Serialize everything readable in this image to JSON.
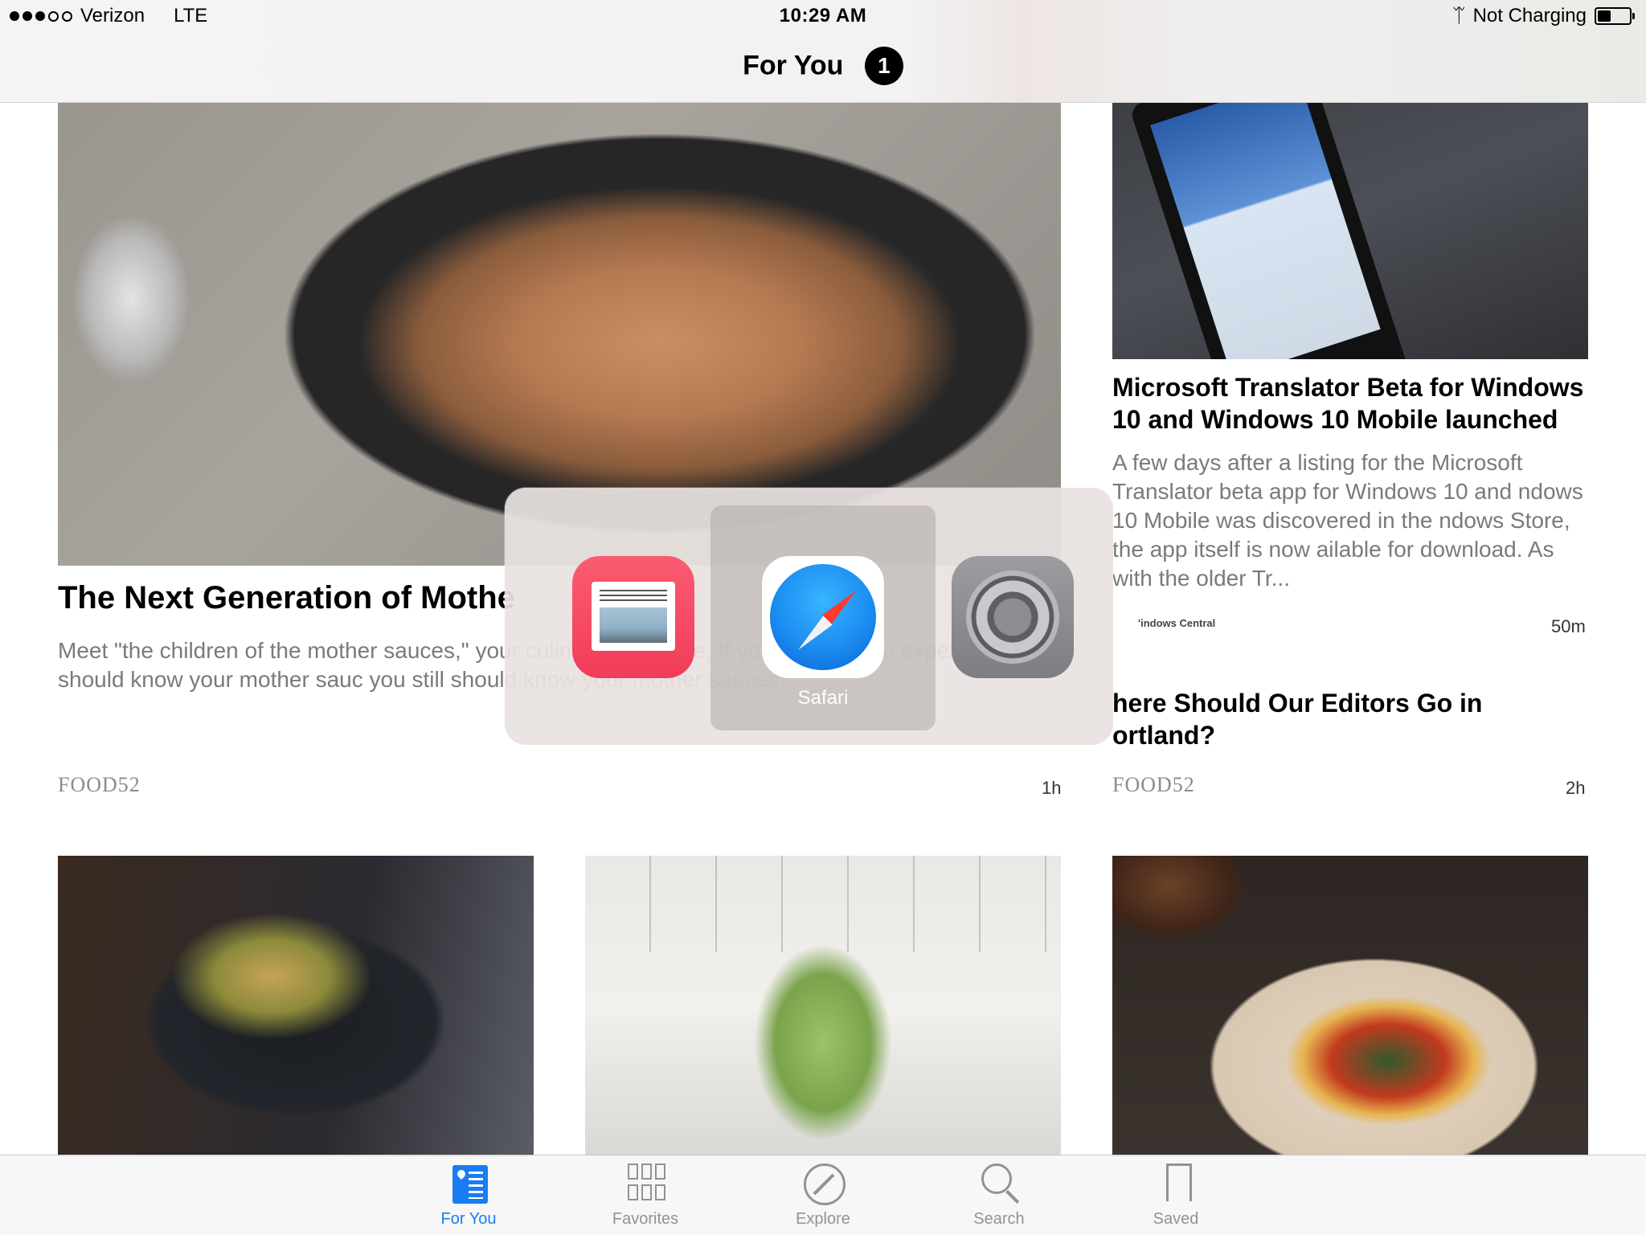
{
  "status_bar": {
    "carrier": "Verizon",
    "network": "LTE",
    "time": "10:29 AM",
    "charging": "Not Charging",
    "battery_level": 0.45,
    "signal_bars_filled": 3,
    "signal_bars_total": 5
  },
  "nav": {
    "title": "For You",
    "badge": "1"
  },
  "articles": {
    "main": {
      "headline": "The Next Generation of Mothe",
      "body": "Meet \"the children of the mother sauces,\" your culinary repertoire. If you consider yo expert, you should know your mother sauc you still should know your mother sauces.",
      "source": "FOOD52",
      "time": "1h"
    },
    "right_top": {
      "headline": "Microsoft Translator Beta for Windows 10 and Windows 10 Mobile launched",
      "body": "A few days after a listing for the Microsoft Translator beta app for Windows 10 and ndows 10 Mobile was discovered in the ndows Store, the app itself is now ailable for download. As with the older Tr...",
      "source": "'indows Central",
      "time": "50m"
    },
    "right_bottom": {
      "headline": "here Should Our Editors Go in ortland?",
      "source": "FOOD52",
      "time": "2h"
    }
  },
  "app_switcher": {
    "selected_label": "Safari",
    "apps": [
      "news-app-icon",
      "safari-app-icon",
      "settings-app-icon"
    ]
  },
  "tab_bar": {
    "tabs": [
      {
        "label": "For You",
        "icon": "for-you-icon",
        "active": true
      },
      {
        "label": "Favorites",
        "icon": "favorites-icon",
        "active": false
      },
      {
        "label": "Explore",
        "icon": "explore-icon",
        "active": false
      },
      {
        "label": "Search",
        "icon": "search-icon",
        "active": false
      },
      {
        "label": "Saved",
        "icon": "saved-icon",
        "active": false
      }
    ]
  },
  "colors": {
    "accent": "#1a7cf2",
    "inactive": "#929292",
    "news_red": "#f13c58"
  }
}
